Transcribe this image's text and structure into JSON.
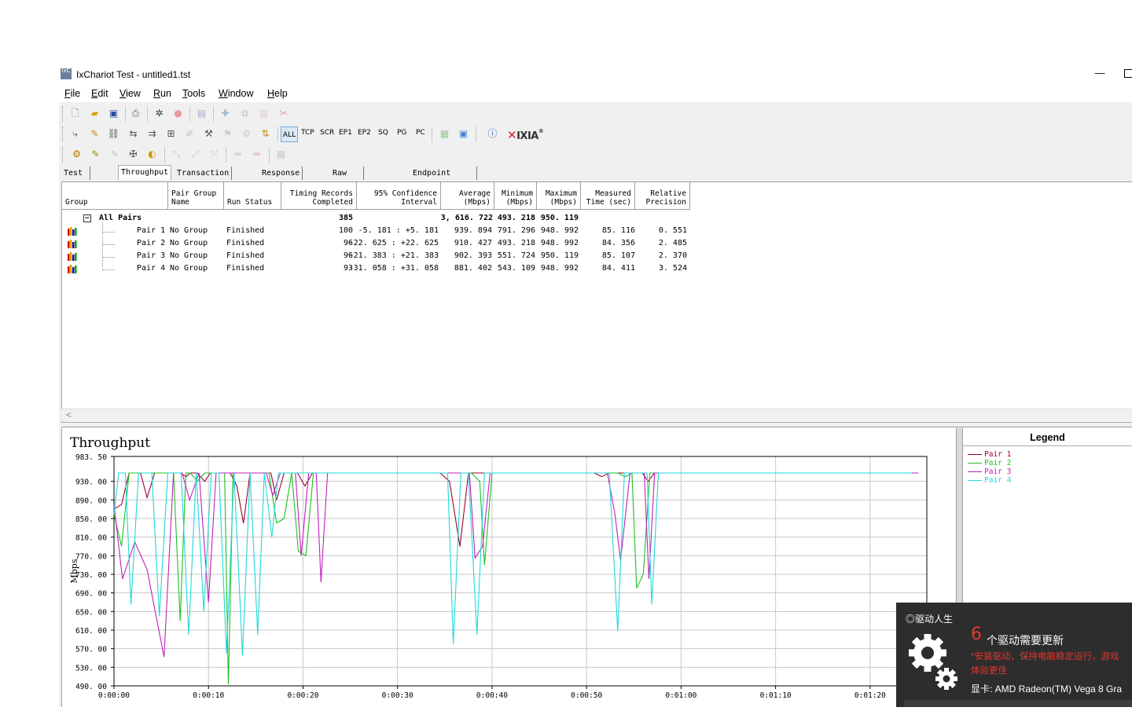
{
  "window": {
    "title": "IxChariot Test - untitled1.tst",
    "icon_text": "IxC",
    "minimize_glyph": "—"
  },
  "menu": [
    {
      "label": "File",
      "u": "F",
      "rest": "ile"
    },
    {
      "label": "Edit",
      "u": "E",
      "rest": "dit"
    },
    {
      "label": "View",
      "u": "V",
      "rest": "iew"
    },
    {
      "label": "Run",
      "u": "R",
      "rest": "un"
    },
    {
      "label": "Tools",
      "u": "T",
      "rest": "ools"
    },
    {
      "label": "Window",
      "u": "W",
      "rest": "indow"
    },
    {
      "label": "Help",
      "u": "H",
      "rest": "elp"
    }
  ],
  "toolbar3": {
    "filters": [
      "ALL",
      "TCP",
      "SCR",
      "EP1",
      "EP2",
      "SQ",
      "PG",
      "PC"
    ],
    "brand_x": "✕",
    "brand": "IXIA",
    "brand_mark": "®"
  },
  "tabs": [
    "Test Setup",
    "Throughput",
    "Transaction Rate",
    "Response Time",
    "Raw Data Totals",
    "Endpoint Configuration"
  ],
  "active_tab": "Throughput",
  "columns": [
    {
      "key": "group",
      "label": "Group"
    },
    {
      "key": "name",
      "label": "Pair Group\nName"
    },
    {
      "key": "status",
      "label": "Run Status"
    },
    {
      "key": "records",
      "label": "Timing Records\nCompleted"
    },
    {
      "key": "ci",
      "label": "95% Confidence\nInterval"
    },
    {
      "key": "avg",
      "label": "Average\n(Mbps)"
    },
    {
      "key": "min",
      "label": "Minimum\n(Mbps)"
    },
    {
      "key": "max",
      "label": "Maximum\n(Mbps)"
    },
    {
      "key": "time",
      "label": "Measured\nTime (sec)"
    },
    {
      "key": "prec",
      "label": "Relative\nPrecision"
    }
  ],
  "summary": {
    "toggle": "−",
    "label": "All Pairs",
    "records": "385",
    "avg": "3, 616. 722",
    "min": "493. 218",
    "max": "950. 119"
  },
  "rows": [
    {
      "pair": "Pair 1",
      "group": "No Group",
      "status": "Finished",
      "records": "100",
      "ci": "-5. 181 : +5. 181",
      "avg": "939. 894",
      "min": "791. 296",
      "max": "948. 992",
      "time": "85. 116",
      "prec": "0. 551"
    },
    {
      "pair": "Pair 2",
      "group": "No Group",
      "status": "Finished",
      "records": "96",
      "ci": "-22. 625 : +22. 625",
      "avg": "910. 427",
      "min": "493. 218",
      "max": "948. 992",
      "time": "84. 356",
      "prec": "2. 485"
    },
    {
      "pair": "Pair 3",
      "group": "No Group",
      "status": "Finished",
      "records": "96",
      "ci": "-21. 383 : +21. 383",
      "avg": "902. 393",
      "min": "551. 724",
      "max": "950. 119",
      "time": "85. 107",
      "prec": "2. 370"
    },
    {
      "pair": "Pair 4",
      "group": "No Group",
      "status": "Finished",
      "records": "93",
      "ci": "-31. 058 : +31. 058",
      "avg": "881. 402",
      "min": "543. 109",
      "max": "948. 992",
      "time": "84. 411",
      "prec": "3. 524"
    }
  ],
  "scroll_left": "<",
  "chart_data": {
    "type": "line",
    "title": "Throughput",
    "ylabel": "Mbps",
    "xlabel": "",
    "ylim": [
      490.0,
      983.5
    ],
    "yticks": [
      "983. 50",
      "930. 00",
      "890. 00",
      "850. 00",
      "810. 00",
      "770. 00",
      "730. 00",
      "690. 00",
      "650. 00",
      "610. 00",
      "570. 00",
      "530. 00",
      "490. 00"
    ],
    "ytick_values": [
      983.5,
      930,
      890,
      850,
      810,
      770,
      730,
      690,
      650,
      610,
      570,
      530,
      490
    ],
    "xlim": [
      0,
      86
    ],
    "xticks": [
      "0:00:00",
      "0:00:10",
      "0:00:20",
      "0:00:30",
      "0:00:40",
      "0:00:50",
      "0:01:00",
      "0:01:10",
      "0:01:20"
    ],
    "xtick_values": [
      0,
      10,
      20,
      30,
      40,
      50,
      60,
      70,
      80
    ],
    "grid": true,
    "legend_title": "Legend",
    "series": [
      {
        "name": "Pair 1",
        "color": "#a00030",
        "points": [
          [
            0,
            870
          ],
          [
            0.8,
            880
          ],
          [
            1.6,
            948
          ],
          [
            2.8,
            948
          ],
          [
            3.5,
            895
          ],
          [
            4.3,
            948
          ],
          [
            5.0,
            948
          ],
          [
            5.6,
            948
          ],
          [
            6.3,
            948
          ],
          [
            7.0,
            948
          ],
          [
            7.6,
            940
          ],
          [
            8.1,
            948
          ],
          [
            8.8,
            948
          ],
          [
            9.6,
            930
          ],
          [
            10.2,
            948
          ],
          [
            11.0,
            948
          ],
          [
            11.7,
            948
          ],
          [
            12.3,
            948
          ],
          [
            13.0,
            920
          ],
          [
            13.7,
            840
          ],
          [
            14.4,
            948
          ],
          [
            15.2,
            948
          ],
          [
            15.8,
            948
          ],
          [
            16.6,
            948
          ],
          [
            17.2,
            890
          ],
          [
            18.0,
            948
          ],
          [
            18.6,
            948
          ],
          [
            19.4,
            948
          ],
          [
            20.2,
            920
          ],
          [
            21.0,
            948
          ],
          [
            21.8,
            948
          ],
          [
            22.6,
            948
          ],
          [
            23.4,
            948
          ],
          [
            24.2,
            948
          ],
          [
            26,
            948
          ],
          [
            28,
            948
          ],
          [
            30,
            948
          ],
          [
            33,
            948
          ],
          [
            34.5,
            948
          ],
          [
            35.5,
            930
          ],
          [
            36.6,
            790
          ],
          [
            37.5,
            948
          ],
          [
            38.3,
            948
          ],
          [
            39.1,
            948
          ],
          [
            39.8,
            948
          ],
          [
            40.6,
            948
          ],
          [
            45,
            948
          ],
          [
            50,
            948
          ],
          [
            50.8,
            948
          ],
          [
            51.6,
            940
          ],
          [
            52.4,
            948
          ],
          [
            53.4,
            948
          ],
          [
            54.3,
            948
          ],
          [
            55.1,
            948
          ],
          [
            55.9,
            948
          ],
          [
            56.5,
            930
          ],
          [
            57.2,
            948
          ],
          [
            60,
            948
          ],
          [
            65,
            948
          ],
          [
            70,
            948
          ],
          [
            75,
            948
          ],
          [
            80,
            948
          ],
          [
            85.1,
            948
          ]
        ]
      },
      {
        "name": "Pair 2",
        "color": "#20c020",
        "points": [
          [
            0,
            860
          ],
          [
            0.8,
            790
          ],
          [
            1.6,
            948
          ],
          [
            2.8,
            948
          ],
          [
            3.5,
            948
          ],
          [
            4.3,
            948
          ],
          [
            5.0,
            948
          ],
          [
            5.6,
            948
          ],
          [
            6.3,
            948
          ],
          [
            7.0,
            630
          ],
          [
            7.6,
            948
          ],
          [
            8.1,
            948
          ],
          [
            8.8,
            930
          ],
          [
            9.6,
            948
          ],
          [
            10.2,
            948
          ],
          [
            11.0,
            948
          ],
          [
            11.7,
            948
          ],
          [
            12.1,
            493
          ],
          [
            12.6,
            948
          ],
          [
            13.2,
            948
          ],
          [
            14.0,
            948
          ],
          [
            14.8,
            948
          ],
          [
            15.6,
            948
          ],
          [
            16.4,
            948
          ],
          [
            17.2,
            840
          ],
          [
            18.0,
            850
          ],
          [
            18.8,
            948
          ],
          [
            19.5,
            780
          ],
          [
            20.3,
            770
          ],
          [
            21.1,
            948
          ],
          [
            21.9,
            948
          ],
          [
            22.6,
            948
          ],
          [
            23.5,
            948
          ],
          [
            24.4,
            948
          ],
          [
            26,
            948
          ],
          [
            28,
            948
          ],
          [
            30,
            948
          ],
          [
            33,
            948
          ],
          [
            34.5,
            948
          ],
          [
            35.3,
            948
          ],
          [
            36.0,
            948
          ],
          [
            36.8,
            948
          ],
          [
            37.8,
            948
          ],
          [
            38.7,
            930
          ],
          [
            39.2,
            750
          ],
          [
            40.0,
            948
          ],
          [
            45,
            948
          ],
          [
            50,
            948
          ],
          [
            50.8,
            948
          ],
          [
            51.6,
            948
          ],
          [
            52.4,
            948
          ],
          [
            53.3,
            948
          ],
          [
            54.1,
            940
          ],
          [
            54.8,
            948
          ],
          [
            55.3,
            700
          ],
          [
            56.0,
            730
          ],
          [
            56.7,
            948
          ],
          [
            57.4,
            948
          ],
          [
            60,
            948
          ],
          [
            65,
            948
          ],
          [
            70,
            948
          ],
          [
            75,
            948
          ],
          [
            80,
            948
          ],
          [
            84.4,
            948
          ]
        ]
      },
      {
        "name": "Pair 3",
        "color": "#c020c0",
        "points": [
          [
            0,
            880
          ],
          [
            0.9,
            720
          ],
          [
            2.2,
            800
          ],
          [
            3.5,
            740
          ],
          [
            5.3,
            552
          ],
          [
            6.3,
            948
          ],
          [
            7.2,
            948
          ],
          [
            8.0,
            890
          ],
          [
            9.0,
            948
          ],
          [
            10.0,
            670
          ],
          [
            10.8,
            948
          ],
          [
            11.6,
            948
          ],
          [
            12.3,
            948
          ],
          [
            13.0,
            948
          ],
          [
            13.7,
            948
          ],
          [
            14.5,
            948
          ],
          [
            15.3,
            948
          ],
          [
            16.1,
            948
          ],
          [
            16.8,
            900
          ],
          [
            17.6,
            948
          ],
          [
            18.4,
            948
          ],
          [
            19.2,
            948
          ],
          [
            19.8,
            770
          ],
          [
            20.6,
            948
          ],
          [
            21.4,
            948
          ],
          [
            21.9,
            713
          ],
          [
            22.6,
            948
          ],
          [
            23.4,
            948
          ],
          [
            24.2,
            948
          ],
          [
            26,
            948
          ],
          [
            28,
            948
          ],
          [
            30,
            948
          ],
          [
            33,
            948
          ],
          [
            34.5,
            948
          ],
          [
            35.2,
            948
          ],
          [
            36.0,
            948
          ],
          [
            36.8,
            948
          ],
          [
            37.6,
            948
          ],
          [
            38.2,
            765
          ],
          [
            39.0,
            790
          ],
          [
            39.8,
            948
          ],
          [
            45,
            948
          ],
          [
            50,
            948
          ],
          [
            50.6,
            948
          ],
          [
            51.4,
            948
          ],
          [
            52.2,
            948
          ],
          [
            53.0,
            860
          ],
          [
            53.6,
            760
          ],
          [
            54.6,
            948
          ],
          [
            55.4,
            948
          ],
          [
            56.1,
            948
          ],
          [
            56.6,
            720
          ],
          [
            57.2,
            948
          ],
          [
            60,
            948
          ],
          [
            65,
            948
          ],
          [
            70,
            948
          ],
          [
            75,
            948
          ],
          [
            80,
            948
          ],
          [
            85.1,
            948
          ]
        ]
      },
      {
        "name": "Pair 4",
        "color": "#20d8d8",
        "points": [
          [
            0,
            860
          ],
          [
            0.5,
            948
          ],
          [
            1.2,
            948
          ],
          [
            1.8,
            665
          ],
          [
            2.6,
            948
          ],
          [
            3.3,
            948
          ],
          [
            4.0,
            948
          ],
          [
            4.8,
            640
          ],
          [
            5.7,
            948
          ],
          [
            6.3,
            948
          ],
          [
            7.1,
            948
          ],
          [
            7.9,
            600
          ],
          [
            8.7,
            948
          ],
          [
            9.5,
            650
          ],
          [
            10.3,
            948
          ],
          [
            11.1,
            948
          ],
          [
            11.9,
            560
          ],
          [
            12.7,
            948
          ],
          [
            13.6,
            555
          ],
          [
            14.4,
            948
          ],
          [
            15.2,
            600
          ],
          [
            15.9,
            948
          ],
          [
            16.7,
            810
          ],
          [
            17.4,
            948
          ],
          [
            18.2,
            948
          ],
          [
            19.0,
            948
          ],
          [
            19.8,
            948
          ],
          [
            20.6,
            948
          ],
          [
            21.4,
            948
          ],
          [
            22.2,
            948
          ],
          [
            23.0,
            948
          ],
          [
            24.0,
            948
          ],
          [
            26,
            948
          ],
          [
            28,
            948
          ],
          [
            30,
            948
          ],
          [
            33,
            948
          ],
          [
            34.5,
            948
          ],
          [
            35.3,
            948
          ],
          [
            35.9,
            580
          ],
          [
            36.7,
            948
          ],
          [
            37.5,
            948
          ],
          [
            38.4,
            600
          ],
          [
            39.2,
            948
          ],
          [
            39.9,
            948
          ],
          [
            45,
            948
          ],
          [
            50,
            948
          ],
          [
            50.8,
            948
          ],
          [
            51.6,
            948
          ],
          [
            52.4,
            948
          ],
          [
            53.3,
            608
          ],
          [
            54.0,
            948
          ],
          [
            54.8,
            948
          ],
          [
            55.6,
            948
          ],
          [
            56.4,
            948
          ],
          [
            56.9,
            665
          ],
          [
            57.6,
            948
          ],
          [
            60,
            948
          ],
          [
            65,
            948
          ],
          [
            70,
            948
          ],
          [
            75,
            948
          ],
          [
            80,
            948
          ],
          [
            84.4,
            948
          ]
        ]
      }
    ]
  },
  "notify": {
    "brand": "◎驱动人生",
    "count": "6",
    "headline": "个驱动需要更新",
    "sub": "*安装驱动，保持电脑稳定运行，游戏体验更佳",
    "gpu": "显卡: AMD Radeon(TM) Vega 8 Gra"
  }
}
